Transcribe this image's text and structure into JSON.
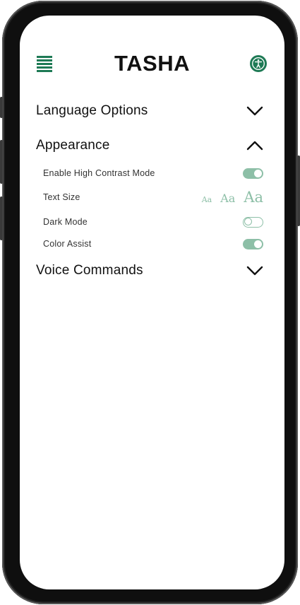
{
  "app": {
    "title": "TASHA"
  },
  "icons": {
    "menu": "hamburger-menu-icon",
    "accessibility": "accessibility-icon"
  },
  "colors": {
    "accent": "#1e7a55",
    "toggle": "#8dbfa7",
    "text": "#111111"
  },
  "sections": {
    "language": {
      "label": "Language Options",
      "expanded": false
    },
    "appearance": {
      "label": "Appearance",
      "expanded": true
    },
    "voice": {
      "label": "Voice Commands",
      "expanded": false
    }
  },
  "appearance": {
    "high_contrast": {
      "label": "Enable High Contrast Mode",
      "on": true
    },
    "text_size": {
      "label": "Text Size",
      "options": [
        "Aa",
        "Aa",
        "Aa"
      ]
    },
    "dark_mode": {
      "label": "Dark Mode",
      "on": false
    },
    "color_assist": {
      "label": "Color Assist",
      "on": true
    }
  }
}
